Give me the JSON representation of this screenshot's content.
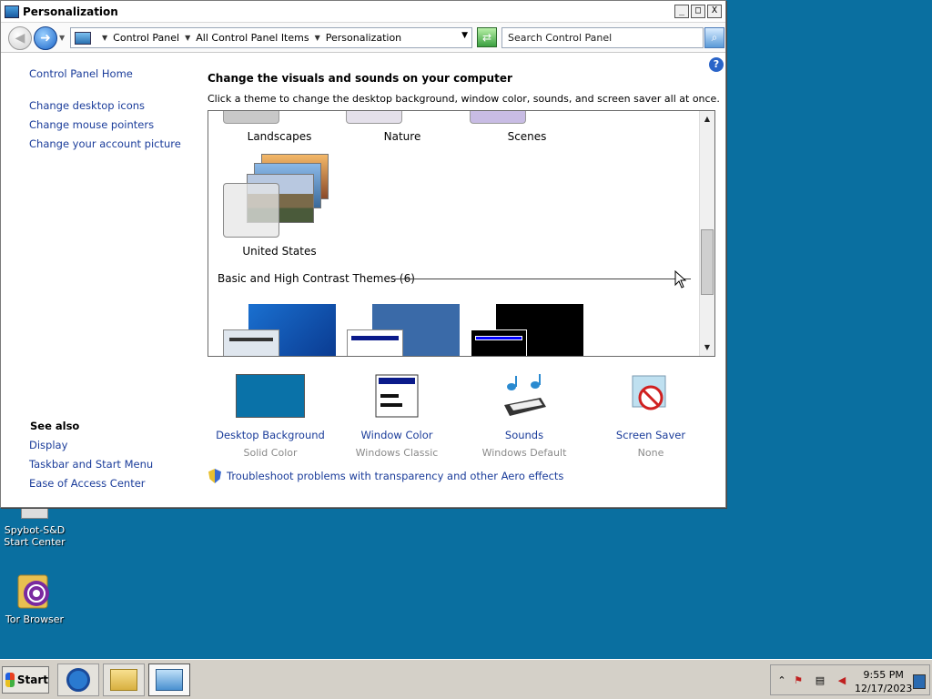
{
  "window": {
    "title": "Personalization",
    "controls": {
      "minimize": "_",
      "maximize": "□",
      "close": "X"
    }
  },
  "navbar": {
    "breadcrumb": [
      "Control Panel",
      "All Control Panel Items",
      "Personalization"
    ],
    "search_placeholder": "Search Control Panel"
  },
  "sidebar": {
    "home": "Control Panel Home",
    "links": [
      "Change desktop icons",
      "Change mouse pointers",
      "Change your account picture"
    ],
    "see_also_title": "See also",
    "see_also": [
      "Display",
      "Taskbar and Start Menu",
      "Ease of Access Center"
    ]
  },
  "main": {
    "heading": "Change the visuals and sounds on your computer",
    "subheading": "Click a theme to change the desktop background, window color, sounds, and screen saver all at once.",
    "themes_top": [
      "Landscapes",
      "Nature",
      "Scenes"
    ],
    "theme_us": "United States",
    "basic_group": "Basic and High Contrast Themes (6)",
    "settings": [
      {
        "name": "Desktop Background",
        "value": "Solid Color",
        "icon": "solid-color-swatch-icon"
      },
      {
        "name": "Window Color",
        "value": "Windows Classic",
        "icon": "window-color-icon"
      },
      {
        "name": "Sounds",
        "value": "Windows Default",
        "icon": "sounds-icon"
      },
      {
        "name": "Screen Saver",
        "value": "None",
        "icon": "screen-saver-icon"
      }
    ],
    "troubleshoot": "Troubleshoot problems with transparency and other Aero effects"
  },
  "desktop": {
    "icons": [
      "Spybot-S&D Start Center",
      "Tor Browser"
    ]
  },
  "taskbar": {
    "start": "Start",
    "time": "9:55 PM",
    "date": "12/17/2023"
  },
  "colors": {
    "desktop": "#0a6fa0",
    "link": "#1a3c9a",
    "solid_color_swatch": "#0a72a8"
  }
}
